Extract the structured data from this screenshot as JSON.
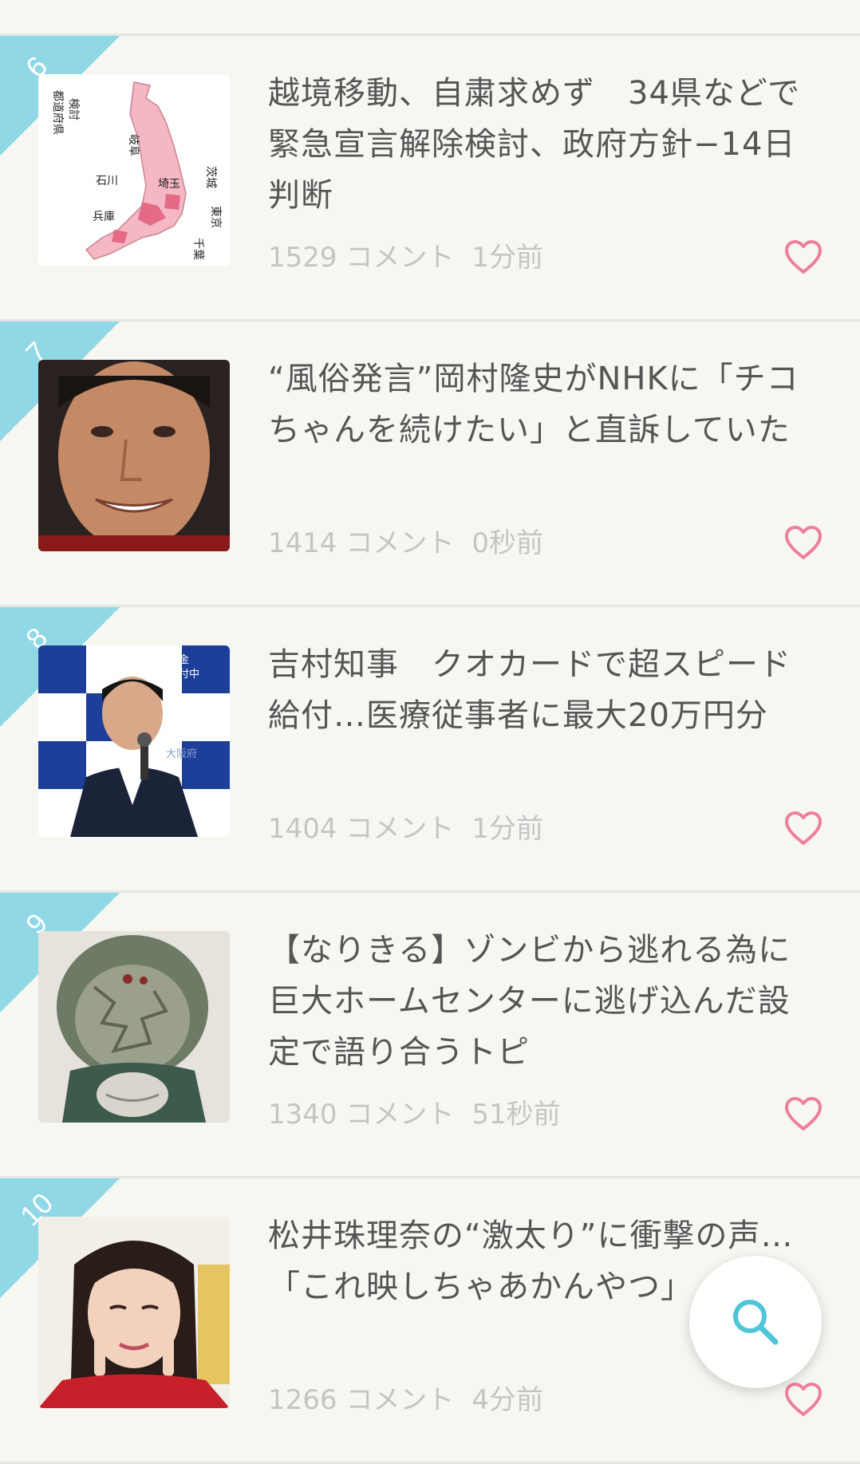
{
  "topics": [
    {
      "rank": "6",
      "title": "越境移動、自粛求めず　34県などで緊急宣言解除検討、政府方針−14日判断",
      "comments": "1529 コメント",
      "time": "1分前",
      "thumb_labels": [
        "検討",
        "都道府県",
        "岐阜",
        "石川",
        "埼玉",
        "茨城",
        "東京",
        "兵庫",
        "千葉"
      ]
    },
    {
      "rank": "7",
      "title": "“風俗発言”岡村隆史がNHKに「チコちゃんを続けたい」と直訴していた",
      "comments": "1414 コメント",
      "time": "0秒前"
    },
    {
      "rank": "8",
      "title": "吉村知事　クオカードで超スピード給付…医療従事者に最大20万円分",
      "comments": "1404 コメント",
      "time": "1分前",
      "thumb_labels": [
        "支援金",
        "護受付中",
        "大阪府"
      ]
    },
    {
      "rank": "9",
      "title": "【なりきる】ゾンビから逃れる為に巨大ホームセンターに逃げ込んだ設定で語り合うトピ",
      "comments": "1340 コメント",
      "time": "51秒前"
    },
    {
      "rank": "10",
      "title": "松井珠理奈の“激太り”に衝撃の声…「これ映しちゃあかんやつ」",
      "comments": "1266 コメント",
      "time": "4分前"
    }
  ],
  "icons": {
    "favorite": "heart-icon",
    "search": "search-icon"
  },
  "colors": {
    "ribbon": "#90d8e6",
    "heart": "#ee7f9a",
    "search": "#4fc6d8",
    "title_text": "#555555",
    "meta_text": "#c4c4c4",
    "background": "#f7f7f2"
  }
}
